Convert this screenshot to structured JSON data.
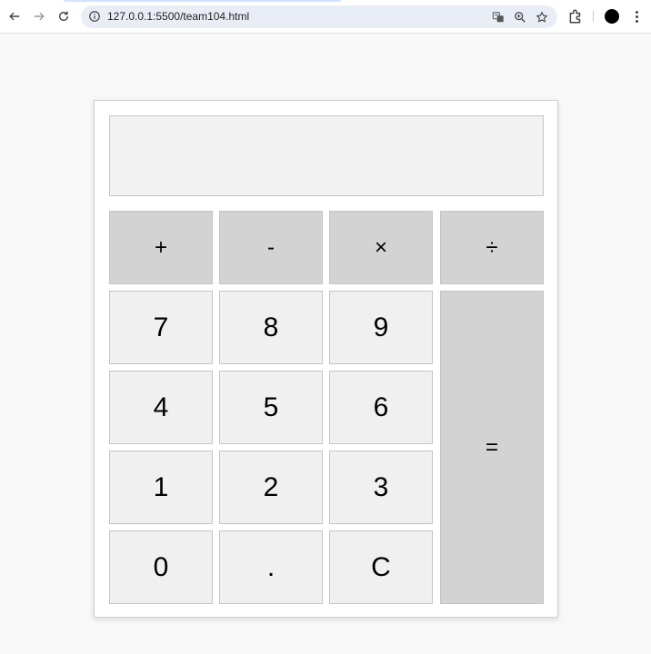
{
  "browser": {
    "url": "127.0.0.1:5500/team104.html"
  },
  "calculator": {
    "display_value": "",
    "operators": {
      "add": "+",
      "subtract": "-",
      "multiply": "×",
      "divide": "÷"
    },
    "digits": {
      "seven": "7",
      "eight": "8",
      "nine": "9",
      "four": "4",
      "five": "5",
      "six": "6",
      "one": "1",
      "two": "2",
      "three": "3",
      "zero": "0"
    },
    "decimal": ".",
    "clear": "C",
    "equals": "="
  }
}
